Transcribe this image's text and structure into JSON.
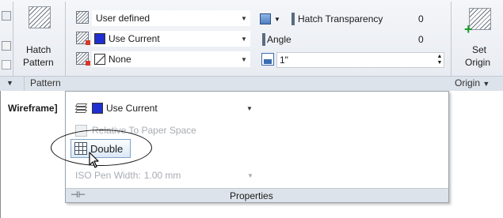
{
  "ribbon": {
    "hatch_pattern_button": {
      "line1": "Hatch",
      "line2": "Pattern"
    },
    "set_origin_button": {
      "line1": "Set",
      "line2": "Origin"
    },
    "panels": {
      "pattern_label": "Pattern",
      "origin_label": "Origin"
    },
    "hatch_type": {
      "value": "User defined"
    },
    "hatch_color": {
      "value": "Use Current",
      "swatch_color": "#1f2fd0"
    },
    "background_color": {
      "value": "None"
    },
    "hatch_transparency": {
      "label": "Hatch Transparency",
      "value": "0"
    },
    "angle": {
      "label": "Angle",
      "value": "0"
    },
    "spacing": {
      "value": "1\""
    }
  },
  "canvas": {
    "viewport_label": "Wireframe]"
  },
  "properties_dropdown": {
    "layer": {
      "value": "Use Current",
      "swatch_color": "#1f2fd0"
    },
    "relative_to_paper_space": {
      "label": "Relative To Paper Space"
    },
    "double": {
      "label": "Double"
    },
    "iso_pen_width": {
      "label": "ISO Pen Width:",
      "value": "1.00 mm"
    },
    "footer_title": "Properties"
  }
}
